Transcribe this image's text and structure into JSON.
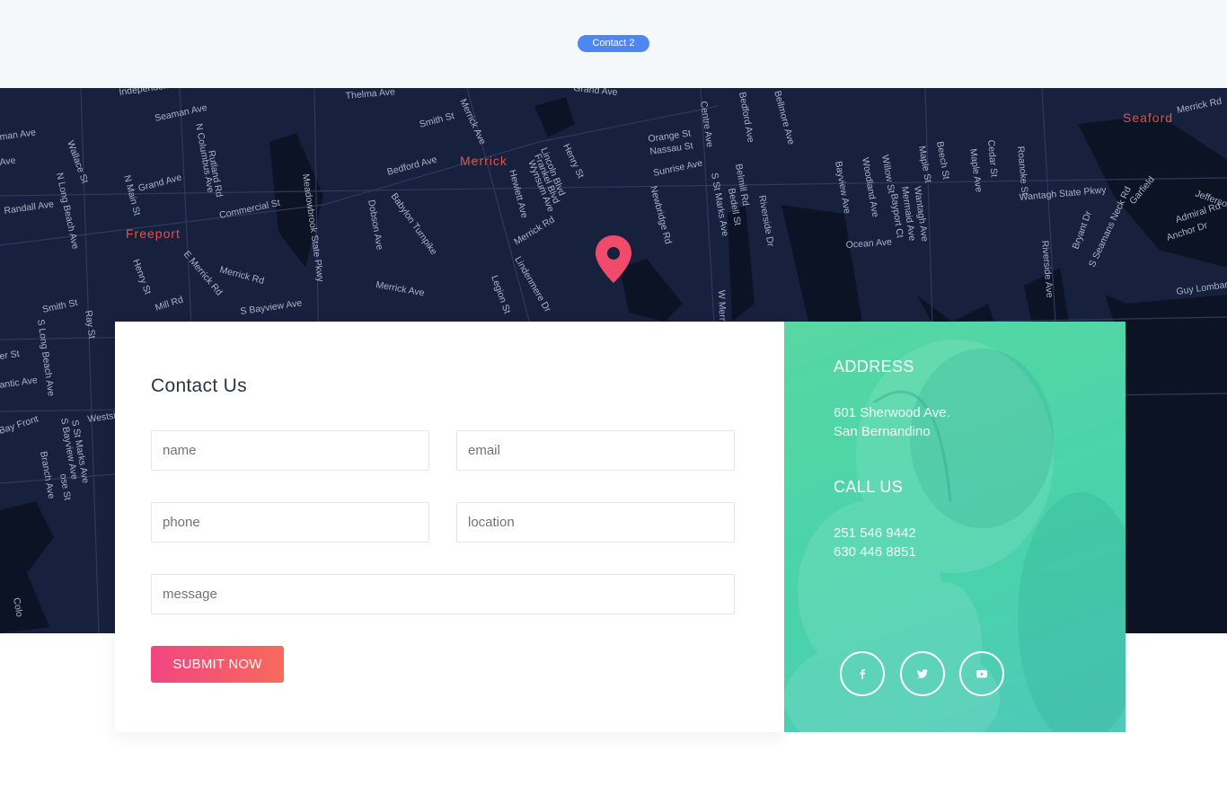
{
  "header": {
    "badge_label": "Contact 2"
  },
  "map": {
    "towns": [
      "Merrick",
      "Freeport",
      "Seaford"
    ],
    "streets": [
      "Independence",
      "Thelma Ave",
      "Grand Ave",
      "Seaman Ave",
      "Smith St",
      "Merrick Ave",
      "Bellmore Ave",
      "Merrick Rd",
      "man Ave",
      "Ave",
      "Wallace St",
      "N Columbus Ave",
      "Rutland Rd",
      "Bedford Ave",
      "Orange St",
      "Nassau St",
      "Centre Ave",
      "Bedford Ave",
      "Beech St",
      "Cedar St",
      "Randall Ave",
      "N Long Beach Ave",
      "N Main St",
      "Grand Ave",
      "Commercial St",
      "Meadowbrook State Pkwy",
      "Dobson Ave",
      "Babylon Turnpike",
      "Henry St",
      "Lincoln Blvd",
      "Frankel Blvd",
      "Wynsum Ave",
      "Hewlett Ave",
      "Merrick Rd",
      "Newbridge Rd",
      "Sunrise Ave",
      "S St Marks Ave",
      "Belmill Rd",
      "Bedell St",
      "Riverside Dr",
      "Bayview Ave",
      "Woodland Ave",
      "Willow St",
      "Maple St",
      "Maple Ave",
      "Roanoke St",
      "Wantagh State Pkwy",
      "Wantagh Ave",
      "Mermaid Ave",
      "Bayport Ct",
      "Ocean Ave",
      "Riverside Ave",
      "Bryant Dr",
      "S Seamans Neck Rd",
      "Garfield",
      "Jefferson Pl",
      "Admiral Rd",
      "Anchor Dr",
      "Guy Lombardo Ave",
      "Henry St",
      "E Merrick Rd",
      "Merrick Rd",
      "Merrick Ave",
      "Lindenmere Dr",
      "Legion St",
      "W Merrick Rd",
      "Smith St",
      "Mill Rd",
      "S Bayview Ave",
      "S Long Beach Ave",
      "Ray St",
      "Westside Ave",
      "S St Marks Ave",
      "S Bayview Ave",
      "Branch Ave",
      "ose St",
      "er St",
      "antic Ave",
      "Bay Front",
      "Colo"
    ]
  },
  "contact_form": {
    "title": "Contact Us",
    "name_placeholder": "name",
    "email_placeholder": "email",
    "phone_placeholder": "phone",
    "location_placeholder": "location",
    "message_placeholder": "message",
    "submit_label": "SUBMIT NOW"
  },
  "info": {
    "address_heading": "ADDRESS",
    "address_line1": "601 Sherwood Ave.",
    "address_line2": "San Bernandino",
    "call_heading": "CALL US",
    "phone1": "251 546 9442",
    "phone2": "630 446 8851"
  },
  "social": {
    "icons": [
      "facebook-icon",
      "twitter-icon",
      "youtube-icon"
    ]
  },
  "colors": {
    "badge": "#4e87f2",
    "map_bg": "#17213d",
    "town_label": "#e2534b",
    "pin": "#f24a6b",
    "submit_start": "#f24582",
    "submit_end": "#f76a5b",
    "info_panel": "#4fd4aa"
  }
}
